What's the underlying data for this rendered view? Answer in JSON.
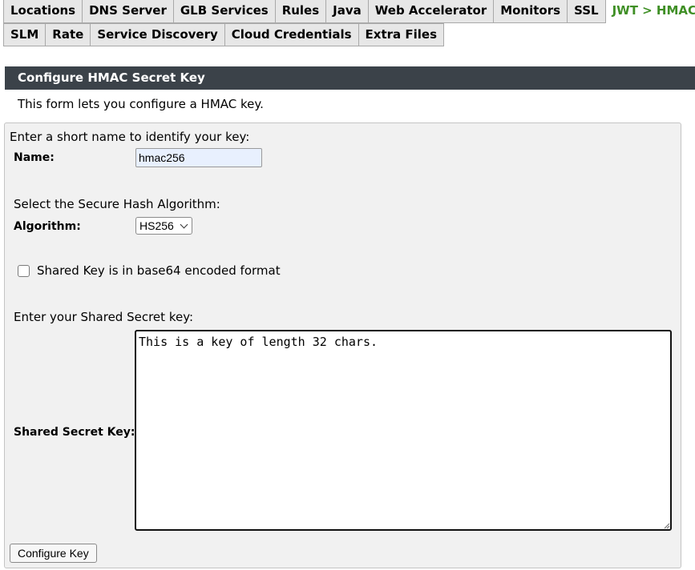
{
  "tabs_row1": [
    {
      "label": "Locations",
      "active": false
    },
    {
      "label": "DNS Server",
      "active": false
    },
    {
      "label": "GLB Services",
      "active": false
    },
    {
      "label": "Rules",
      "active": false
    },
    {
      "label": "Java",
      "active": false
    },
    {
      "label": "Web Accelerator",
      "active": false
    },
    {
      "label": "Monitors",
      "active": false
    },
    {
      "label": "SSL",
      "active": false
    },
    {
      "label": "JWT > HMAC",
      "active": true
    }
  ],
  "tabs_row2": [
    {
      "label": "SLM"
    },
    {
      "label": "Rate"
    },
    {
      "label": "Service Discovery"
    },
    {
      "label": "Cloud Credentials"
    },
    {
      "label": "Extra Files"
    }
  ],
  "panel": {
    "title": "Configure HMAC Secret Key",
    "description": "This form lets you configure a HMAC key."
  },
  "form": {
    "name_prompt": "Enter a short name to identify your key:",
    "name_label": "Name:",
    "name_value": "hmac256",
    "algorithm_prompt": "Select the Secure Hash Algorithm:",
    "algorithm_label": "Algorithm:",
    "algorithm_value": "HS256",
    "base64_label": "Shared Key is in base64 encoded format",
    "base64_checked": false,
    "secret_prompt": "Enter your Shared Secret key:",
    "secret_label": "Shared Secret Key:",
    "secret_value": "This is a key of length 32 chars.",
    "submit_label": "Configure Key"
  },
  "colors": {
    "active_tab_text": "#3f8f25",
    "header_bg": "#3b4249",
    "form_bg": "#f1f1f1",
    "name_input_bg": "#e8f0fe"
  },
  "icons": {
    "select_arrow": "chevron-down-icon",
    "textarea_grip": "resize-grip-icon"
  }
}
